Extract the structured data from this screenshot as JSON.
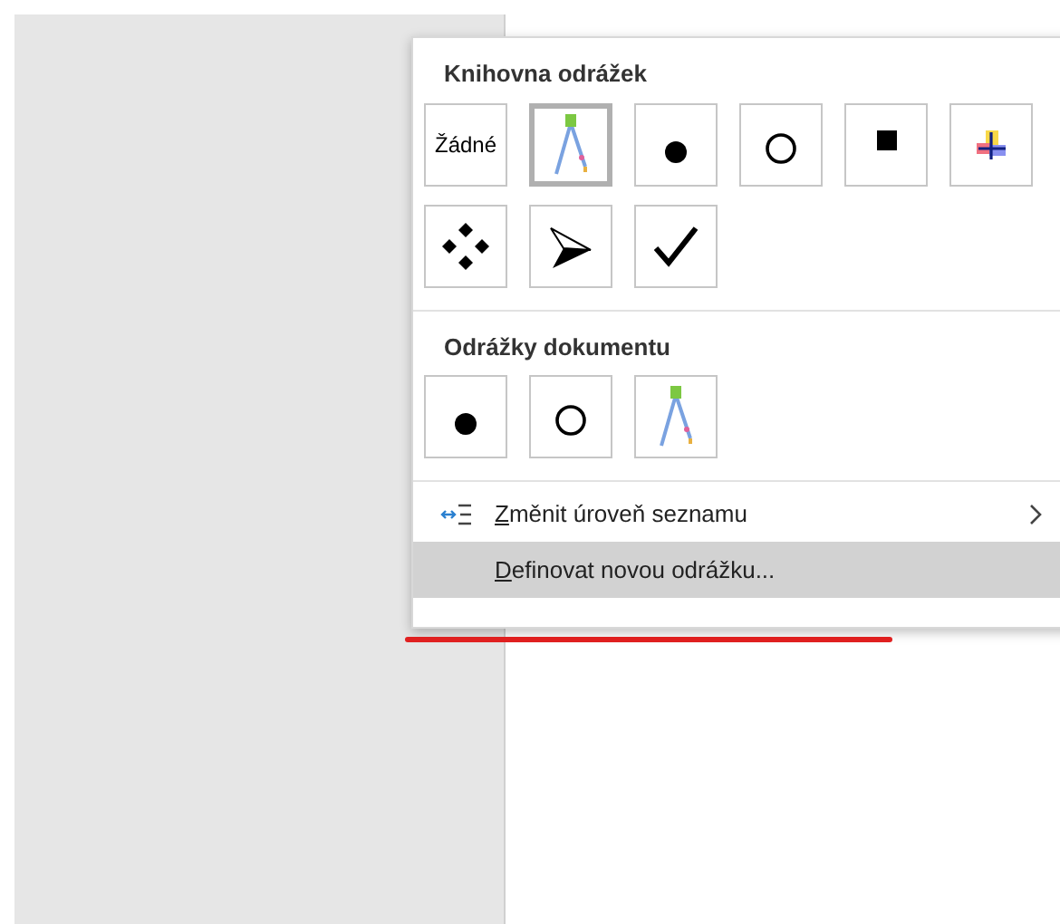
{
  "menu": {
    "sections": [
      {
        "title": "Knihovna odrážek",
        "items": [
          {
            "kind": "text",
            "label": "Žádné",
            "selected": false
          },
          {
            "kind": "compass",
            "selected": true
          },
          {
            "kind": "dot",
            "selected": false
          },
          {
            "kind": "circle",
            "selected": false
          },
          {
            "kind": "square",
            "selected": false
          },
          {
            "kind": "cross",
            "selected": false
          },
          {
            "kind": "diamonds",
            "selected": false
          },
          {
            "kind": "arrow",
            "selected": false
          },
          {
            "kind": "check",
            "selected": false
          }
        ]
      },
      {
        "title": "Odrážky dokumentu",
        "items": [
          {
            "kind": "dot",
            "selected": false
          },
          {
            "kind": "circle",
            "selected": false
          },
          {
            "kind": "compass",
            "selected": false
          }
        ]
      }
    ],
    "commands": [
      {
        "label": "Změnit úroveň seznamu",
        "icon": true,
        "submenu": true,
        "highlighted": false
      },
      {
        "label": "Definovat novou odrážku...",
        "icon": false,
        "submenu": false,
        "highlighted": true
      }
    ]
  }
}
